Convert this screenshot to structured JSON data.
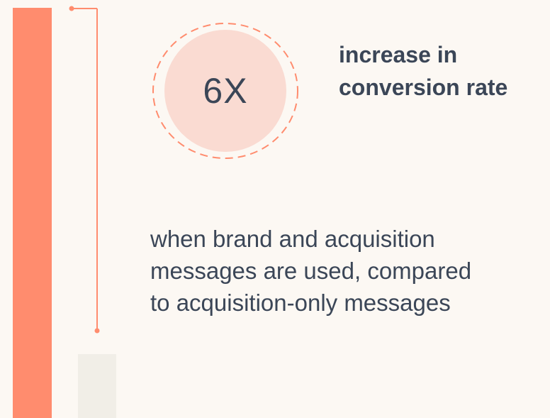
{
  "colors": {
    "accent": "#ff8c6e",
    "circle_fill": "#fadbd2",
    "ink": "#3b4657",
    "muted": "#f1eee7",
    "background": "#fcf8f3"
  },
  "stat": {
    "value": "6X",
    "label_line1": "increase in",
    "label_line2": "conversion rate",
    "description_line1": "when brand and acquisition",
    "description_line2": "messages are used, compared",
    "description_line3": "to acquisition-only messages"
  }
}
